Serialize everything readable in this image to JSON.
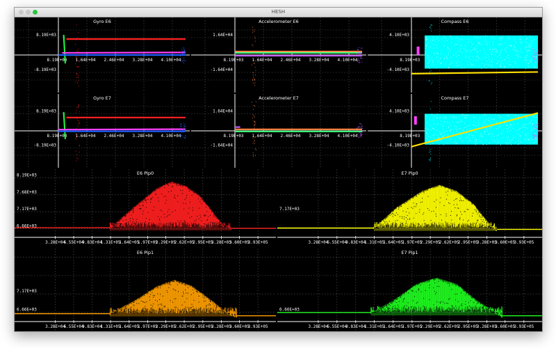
{
  "window": {
    "title": "HESH"
  },
  "chart_data": [
    {
      "id": "gyro-e6",
      "type": "scatter",
      "title": "Gyro E6",
      "grid": true,
      "y_ticks": [
        "8.19E+03",
        "-8.19E+03"
      ],
      "x_ticks": [
        "8.19E+03",
        "1.64E+04",
        "2.46E+04",
        "3.28E+04",
        "4.10E+04"
      ],
      "series": [
        {
          "color": "#ff2020",
          "values": [
            {
              "x": 3000,
              "y": 7500
            },
            {
              "x": 48000,
              "y": 7500
            }
          ]
        },
        {
          "color": "#20ff40",
          "values": [
            {
              "x": 2000,
              "y": 9500
            },
            {
              "x": 2600,
              "y": -4000
            }
          ]
        },
        {
          "color": "#ff40ff",
          "values": [
            {
              "x": 1400,
              "y": 1000
            },
            {
              "x": 48000,
              "y": 1200
            }
          ]
        },
        {
          "color": "#2060ff",
          "values": [
            {
              "x": 0,
              "y": 0
            },
            {
              "x": 48000,
              "y": 0
            }
          ]
        }
      ]
    },
    {
      "id": "accel-e6",
      "type": "scatter",
      "title": "Accelerometer E6",
      "grid": true,
      "y_ticks": [
        "1.64E+04",
        "-1.64E+04"
      ],
      "x_ticks": [
        "8.19E+03",
        "1.64E+04",
        "2.46E+04",
        "3.28E+04",
        "4.10E+04"
      ],
      "series": [
        {
          "color": "#ff8040",
          "values": [
            {
              "x": 0,
              "y": 3300
            },
            {
              "x": 48000,
              "y": 3300
            }
          ]
        },
        {
          "color": "#40ff80",
          "values": [
            {
              "x": 0,
              "y": 2000
            },
            {
              "x": 48000,
              "y": 2000
            }
          ]
        },
        {
          "color": "#c060ff",
          "values": [
            {
              "x": 0,
              "y": -700
            },
            {
              "x": 48000,
              "y": -700
            }
          ]
        }
      ]
    },
    {
      "id": "compass-e6",
      "type": "scatter",
      "title": "Compass E6",
      "grid": true,
      "y_ticks": [
        "4.10E+03",
        "-4.10E+03"
      ],
      "x_ticks": [
        "8.19E+03",
        "1.64E+04",
        "2.46E+04",
        "3.28E+04",
        "4.10E+04"
      ],
      "series": [
        {
          "color": "#00ffff",
          "values": [
            {
              "x": 5000,
              "y": -3200
            },
            {
              "x": 48000,
              "y": 4600
            }
          ]
        },
        {
          "color": "#ffe000",
          "values": [
            {
              "x": 0,
              "y": -4400
            },
            {
              "x": 48000,
              "y": -4000
            }
          ]
        },
        {
          "color": "#ff40ff",
          "values": [
            {
              "x": 2000,
              "y": 1000
            }
          ]
        }
      ]
    },
    {
      "id": "gyro-e7",
      "type": "scatter",
      "title": "Gyro E7",
      "grid": true,
      "y_ticks": [
        "8.19E+03",
        "-8.19E+03"
      ],
      "x_ticks": [
        "8.19E+03",
        "1.64E+04",
        "2.46E+04",
        "3.28E+04",
        "4.10E+04"
      ],
      "series": [
        {
          "color": "#ff2020",
          "values": [
            {
              "x": 3000,
              "y": 6400
            },
            {
              "x": 48000,
              "y": 6400
            }
          ]
        },
        {
          "color": "#20ff40",
          "values": [
            {
              "x": 2000,
              "y": 9000
            },
            {
              "x": 2600,
              "y": -4000
            }
          ]
        },
        {
          "color": "#ff40ff",
          "values": [
            {
              "x": 0,
              "y": 600
            },
            {
              "x": 48000,
              "y": 800
            }
          ]
        },
        {
          "color": "#2060ff",
          "values": [
            {
              "x": 0,
              "y": -200
            },
            {
              "x": 48000,
              "y": -200
            }
          ]
        }
      ]
    },
    {
      "id": "accel-e7",
      "type": "scatter",
      "title": "Accelerometer E7",
      "grid": true,
      "y_ticks": [
        "1.64E+04",
        "-1.64E+04"
      ],
      "x_ticks": [
        "8.19E+03",
        "1.64E+04",
        "2.46E+04",
        "3.28E+04",
        "4.10E+04"
      ],
      "series": [
        {
          "color": "#ff8040",
          "values": [
            {
              "x": 0,
              "y": 1400
            },
            {
              "x": 48000,
              "y": 1400
            }
          ]
        },
        {
          "color": "#40ff80",
          "values": [
            {
              "x": 0,
              "y": -600
            },
            {
              "x": 48000,
              "y": -600
            }
          ]
        },
        {
          "color": "#c060ff",
          "values": [
            {
              "x": 0,
              "y": 3600
            },
            {
              "x": 2000,
              "y": 3600
            }
          ]
        }
      ]
    },
    {
      "id": "compass-e7",
      "type": "scatter",
      "title": "Compass E7",
      "grid": true,
      "y_ticks": [
        "4.10E+03",
        "-4.10E+03"
      ],
      "x_ticks": [
        "8.19E+03",
        "1.64E+04",
        "2.46E+04",
        "3.28E+04",
        "4.10E+04"
      ],
      "series": [
        {
          "color": "#00ffff",
          "values": [
            {
              "x": 5000,
              "y": -3300
            },
            {
              "x": 48000,
              "y": 4100
            }
          ]
        },
        {
          "color": "#ffe000",
          "values": [
            {
              "x": 0,
              "y": -3800
            },
            {
              "x": 48000,
              "y": 4300
            }
          ]
        },
        {
          "color": "#ff40ff",
          "values": [
            {
              "x": 1000,
              "y": 2500
            }
          ]
        }
      ]
    },
    {
      "id": "e6-pip0",
      "type": "scatter",
      "title": "E6 Pip0",
      "grid": true,
      "y_ticks": [
        "8.19E+03",
        "7.68E+03",
        "7.17E+03",
        "6.66E+03"
      ],
      "x_ticks": [
        "3.28E+04",
        "6.55E+04",
        "9.83E+04",
        "1.31E+05",
        "1.64E+05",
        "1.97E+05",
        "2.29E+05",
        "2.62E+05",
        "2.95E+05",
        "3.28E+05",
        "3.60E+05",
        "3.93E+05"
      ],
      "series": [
        {
          "color": "#ff2020",
          "values": [
            {
              "x": 130000,
              "y": 6690
            },
            {
              "x": 175000,
              "y": 7350
            },
            {
              "x": 215000,
              "y": 7900
            },
            {
              "x": 240000,
              "y": 8080
            },
            {
              "x": 265000,
              "y": 7950
            },
            {
              "x": 290000,
              "y": 7650
            },
            {
              "x": 330000,
              "y": 6800
            },
            {
              "x": 345000,
              "y": 6670
            }
          ]
        }
      ]
    },
    {
      "id": "e7-pip0",
      "type": "scatter",
      "title": "E7 Pip0",
      "grid": true,
      "y_ticks": [
        "7.17E+03"
      ],
      "x_ticks": [
        "3.28E+04",
        "6.55E+04",
        "9.83E+04",
        "1.31E+05",
        "1.64E+05",
        "1.97E+05",
        "2.29E+05",
        "2.62E+05",
        "2.95E+05",
        "3.28E+05",
        "3.60E+05",
        "3.93E+05"
      ],
      "series": [
        {
          "color": "#ffff00",
          "values": [
            {
              "x": 130000,
              "y": 6680
            },
            {
              "x": 170000,
              "y": 7300
            },
            {
              "x": 215000,
              "y": 7800
            },
            {
              "x": 245000,
              "y": 7980
            },
            {
              "x": 275000,
              "y": 7800
            },
            {
              "x": 305000,
              "y": 7400
            },
            {
              "x": 335000,
              "y": 6750
            },
            {
              "x": 345000,
              "y": 6640
            }
          ]
        }
      ]
    },
    {
      "id": "e6-pip1",
      "type": "scatter",
      "title": "E6 Pip1",
      "grid": true,
      "y_ticks": [
        "7.17E+03",
        "6.66E+03"
      ],
      "x_ticks": [
        "3.28E+04",
        "6.55E+04",
        "9.83E+04",
        "1.31E+05",
        "1.64E+05",
        "1.97E+05",
        "2.29E+05",
        "2.62E+05",
        "2.95E+05",
        "3.28E+05",
        "3.60E+05",
        "3.93E+05"
      ],
      "series": [
        {
          "color": "#ffa000",
          "values": [
            {
              "x": 130000,
              "y": 6620
            },
            {
              "x": 175000,
              "y": 7000
            },
            {
              "x": 215000,
              "y": 7400
            },
            {
              "x": 245000,
              "y": 7560
            },
            {
              "x": 275000,
              "y": 7400
            },
            {
              "x": 310000,
              "y": 7000
            },
            {
              "x": 340000,
              "y": 6640
            },
            {
              "x": 355000,
              "y": 6560
            }
          ]
        }
      ]
    },
    {
      "id": "e7-pip1",
      "type": "scatter",
      "title": "E7 Pip1",
      "grid": true,
      "y_ticks": [
        "6.66E+03"
      ],
      "x_ticks": [
        "3.28E+04",
        "6.55E+04",
        "9.83E+04",
        "1.31E+05",
        "1.64E+05",
        "1.97E+05",
        "2.29E+05",
        "2.62E+05",
        "2.95E+05",
        "3.28E+05",
        "3.60E+05",
        "3.93E+05"
      ],
      "series": [
        {
          "color": "#20ff20",
          "values": [
            {
              "x": 125000,
              "y": 6650
            },
            {
              "x": 165000,
              "y": 7000
            },
            {
              "x": 205000,
              "y": 7450
            },
            {
              "x": 240000,
              "y": 7620
            },
            {
              "x": 275000,
              "y": 7450
            },
            {
              "x": 310000,
              "y": 7000
            },
            {
              "x": 340000,
              "y": 6700
            },
            {
              "x": 355000,
              "y": 6560
            }
          ]
        }
      ]
    }
  ]
}
